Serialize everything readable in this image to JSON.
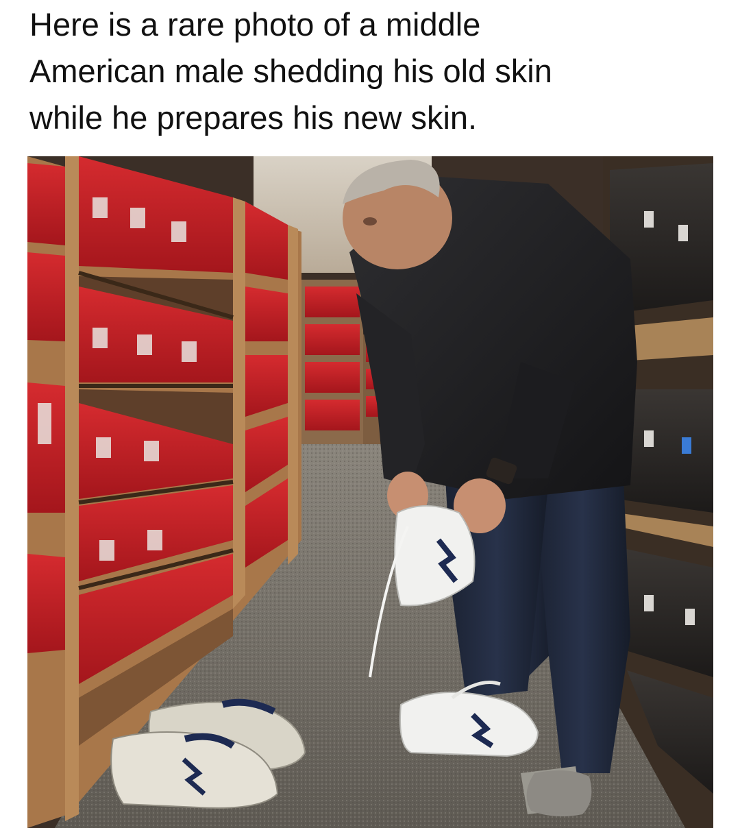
{
  "caption": {
    "lines": [
      "Here is a rare photo of a middle",
      "American male shedding his old skin",
      "while he prepares his new skin."
    ]
  },
  "photo": {
    "subject": "man-trying-on-white-sneakers-in-shoe-store-aisle"
  },
  "colors": {
    "shoebox_red": "#c7222a",
    "shelf_wood": "#a8774a",
    "jacket": "#1f1f22",
    "jeans": "#1e2636",
    "carpet": "#6e6a62",
    "sneaker_white": "#f1f1ef"
  }
}
